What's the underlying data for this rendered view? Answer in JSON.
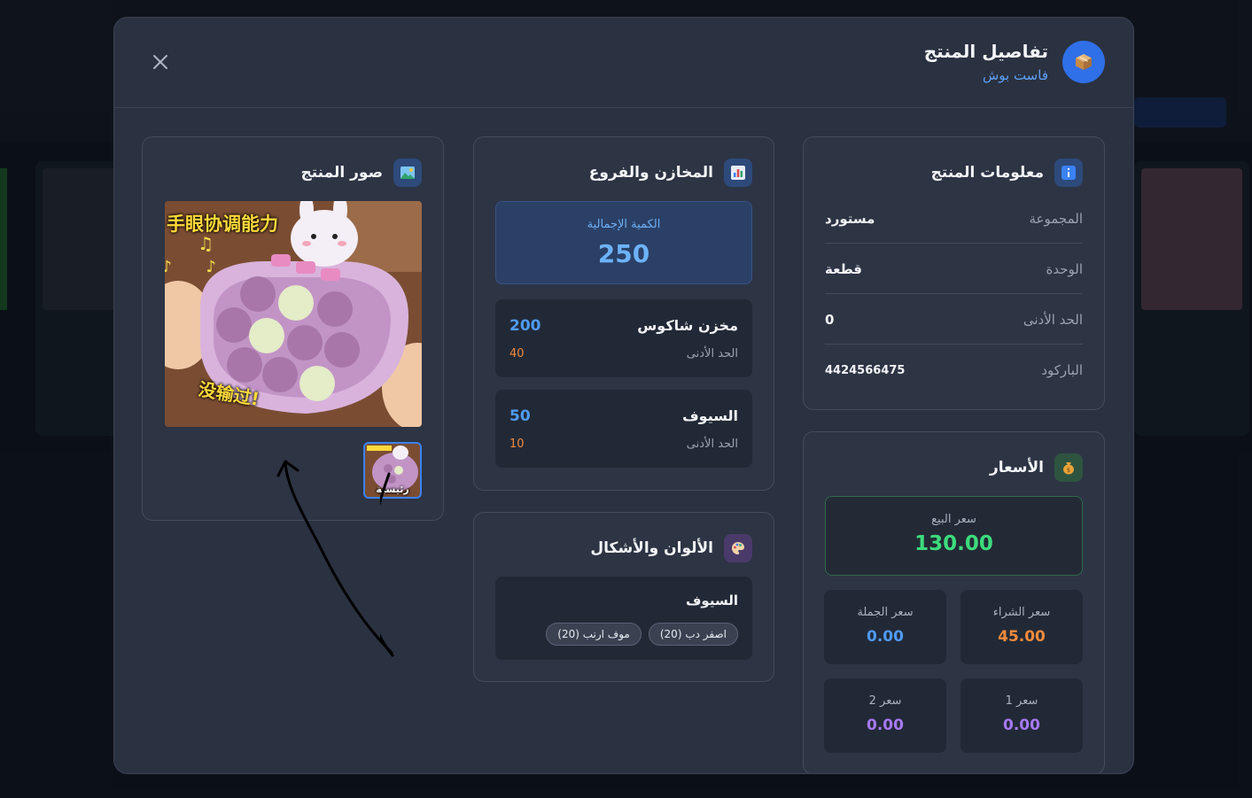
{
  "modal": {
    "title": "تفاصيل المنتج",
    "subtitle": "فاست بوش"
  },
  "info": {
    "title": "معلومات المنتج",
    "rows": [
      {
        "label": "المجموعة",
        "value": "مستورد"
      },
      {
        "label": "الوحدة",
        "value": "قطعة"
      },
      {
        "label": "الحد الأدنى",
        "value": "0"
      },
      {
        "label": "الباركود",
        "value": "4424566475"
      }
    ]
  },
  "prices": {
    "title": "الأسعار",
    "sale": {
      "label": "سعر البيع",
      "value": "130.00"
    },
    "purchase": {
      "label": "سعر الشراء",
      "value": "45.00"
    },
    "wholesale": {
      "label": "سعر الجملة",
      "value": "0.00"
    },
    "price1": {
      "label": "سعر 1",
      "value": "0.00"
    },
    "price2": {
      "label": "سعر 2",
      "value": "0.00"
    },
    "colors": {
      "sale": "#3ddc7c",
      "purchase": "#f08a3c",
      "wholesale": "#4f9bf5",
      "extra": "#a779f5"
    }
  },
  "warehouses": {
    "title": "المخازن والفروع",
    "total": {
      "label": "الكمية الإجمالية",
      "value": "250"
    },
    "items": [
      {
        "name": "مخزن شاكوس",
        "qty": "200",
        "min_label": "الحد الأدنى",
        "min": "40"
      },
      {
        "name": "السيوف",
        "qty": "50",
        "min_label": "الحد الأدنى",
        "min": "10"
      }
    ]
  },
  "colors_shapes": {
    "title": "الألوان والأشكال",
    "group": "السيوف",
    "chips": [
      "اصفر دب (20)",
      "موف ارنب (20)"
    ]
  },
  "images": {
    "title": "صور المنتج",
    "thumb_label": "رئيسية",
    "overlay_text_top": "手眼协调能力",
    "overlay_text_bottom": "没输过!"
  },
  "icons": {
    "header": "package-icon",
    "info": "info-icon",
    "prices": "money-bag-icon",
    "warehouses": "chart-icon",
    "colors": "palette-icon",
    "images": "image-icon",
    "close": "close-icon"
  }
}
